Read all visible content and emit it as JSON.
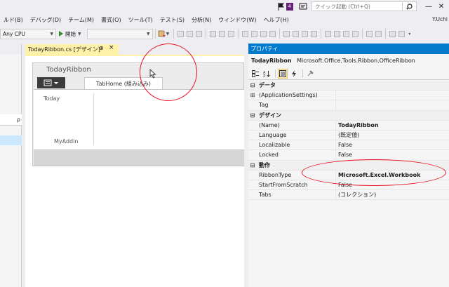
{
  "titlebar": {
    "notification_count": "4",
    "quicklaunch_placeholder": "クイック起動 (Ctrl+Q)",
    "minimize": "—",
    "close": "✕"
  },
  "menu": {
    "items": [
      "ルド(B)",
      "デバッグ(D)",
      "チーム(M)",
      "書式(O)",
      "ツール(T)",
      "テスト(S)",
      "分析(N)",
      "ウィンドウ(W)",
      "ヘルプ(H)"
    ],
    "user": "Y.Uchi"
  },
  "toolbar": {
    "platform": "Any CPU",
    "start_label": "開始",
    "config_value": ""
  },
  "left_panel": {
    "search_glyph": "ρ"
  },
  "document": {
    "tab_title": "TodayRibbon.cs [デザイン]",
    "pin_glyph": "⊕",
    "close_glyph": "×"
  },
  "ribbon": {
    "title": "TodayRibbon",
    "tab_label": "TabHome (組み込み)",
    "group_content_label": "Today",
    "group_name": "MyAddin"
  },
  "properties": {
    "header": "プロパティ",
    "object_name": "TodayRibbon",
    "object_type": "Microsoft.Office.Tools.Ribbon.OfficeRibbon",
    "rows": [
      {
        "kind": "cat",
        "expander": "⊟",
        "name": "データ",
        "value": ""
      },
      {
        "kind": "prop",
        "expander": "⊞",
        "name": "(ApplicationSettings)",
        "value": "",
        "bold": false
      },
      {
        "kind": "prop",
        "expander": "",
        "name": "Tag",
        "value": "",
        "bold": false
      },
      {
        "kind": "cat",
        "expander": "⊟",
        "name": "デザイン",
        "value": ""
      },
      {
        "kind": "prop",
        "expander": "",
        "name": "(Name)",
        "value": "TodayRibbon",
        "bold": true
      },
      {
        "kind": "prop",
        "expander": "",
        "name": "Language",
        "value": "(既定値)",
        "bold": false
      },
      {
        "kind": "prop",
        "expander": "",
        "name": "Localizable",
        "value": "False",
        "bold": false
      },
      {
        "kind": "prop",
        "expander": "",
        "name": "Locked",
        "value": "False",
        "bold": false
      },
      {
        "kind": "cat",
        "expander": "⊟",
        "name": "動作",
        "value": ""
      },
      {
        "kind": "prop",
        "expander": "",
        "name": "RibbonType",
        "value": "Microsoft.Excel.Workbook",
        "bold": true
      },
      {
        "kind": "prop",
        "expander": "",
        "name": "StartFromScratch",
        "value": "False",
        "bold": false
      },
      {
        "kind": "prop",
        "expander": "",
        "name": "Tabs",
        "value": "(コレクション)",
        "bold": false
      }
    ]
  },
  "colors": {
    "accent": "#007acc",
    "doc_tab": "#fff1a8",
    "annotation": "#e81123"
  }
}
